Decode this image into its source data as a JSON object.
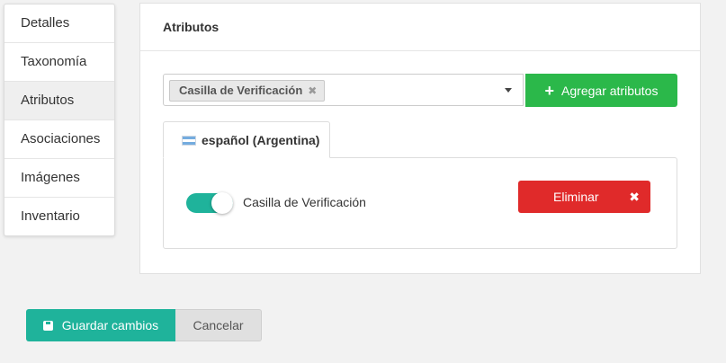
{
  "sidebar": {
    "items": [
      {
        "label": "Detalles"
      },
      {
        "label": "Taxonomía"
      },
      {
        "label": "Atributos",
        "active": true
      },
      {
        "label": "Asociaciones"
      },
      {
        "label": "Imágenes"
      },
      {
        "label": "Inventario"
      }
    ]
  },
  "panel": {
    "title": "Atributos",
    "select": {
      "selected_tags": [
        "Casilla de Verificación"
      ],
      "tag_remove_glyph": "✖"
    },
    "add_button": {
      "icon": "plus-icon",
      "label": "Agregar atributos"
    },
    "tabs": [
      {
        "flag_icon": "argentina-flag-icon",
        "label": "español (Argentina)"
      }
    ],
    "attribute": {
      "label": "Casilla de Verificación",
      "enabled": true,
      "delete_label": "Eliminar",
      "delete_icon": "close-icon",
      "delete_glyph": "✖"
    }
  },
  "footer": {
    "save_label": "Guardar cambios",
    "save_icon": "floppy-disk-icon",
    "cancel_label": "Cancelar"
  },
  "colors": {
    "primary_teal": "#1fb39b",
    "success_green": "#2bb84a",
    "danger_red": "#e02a2a"
  }
}
